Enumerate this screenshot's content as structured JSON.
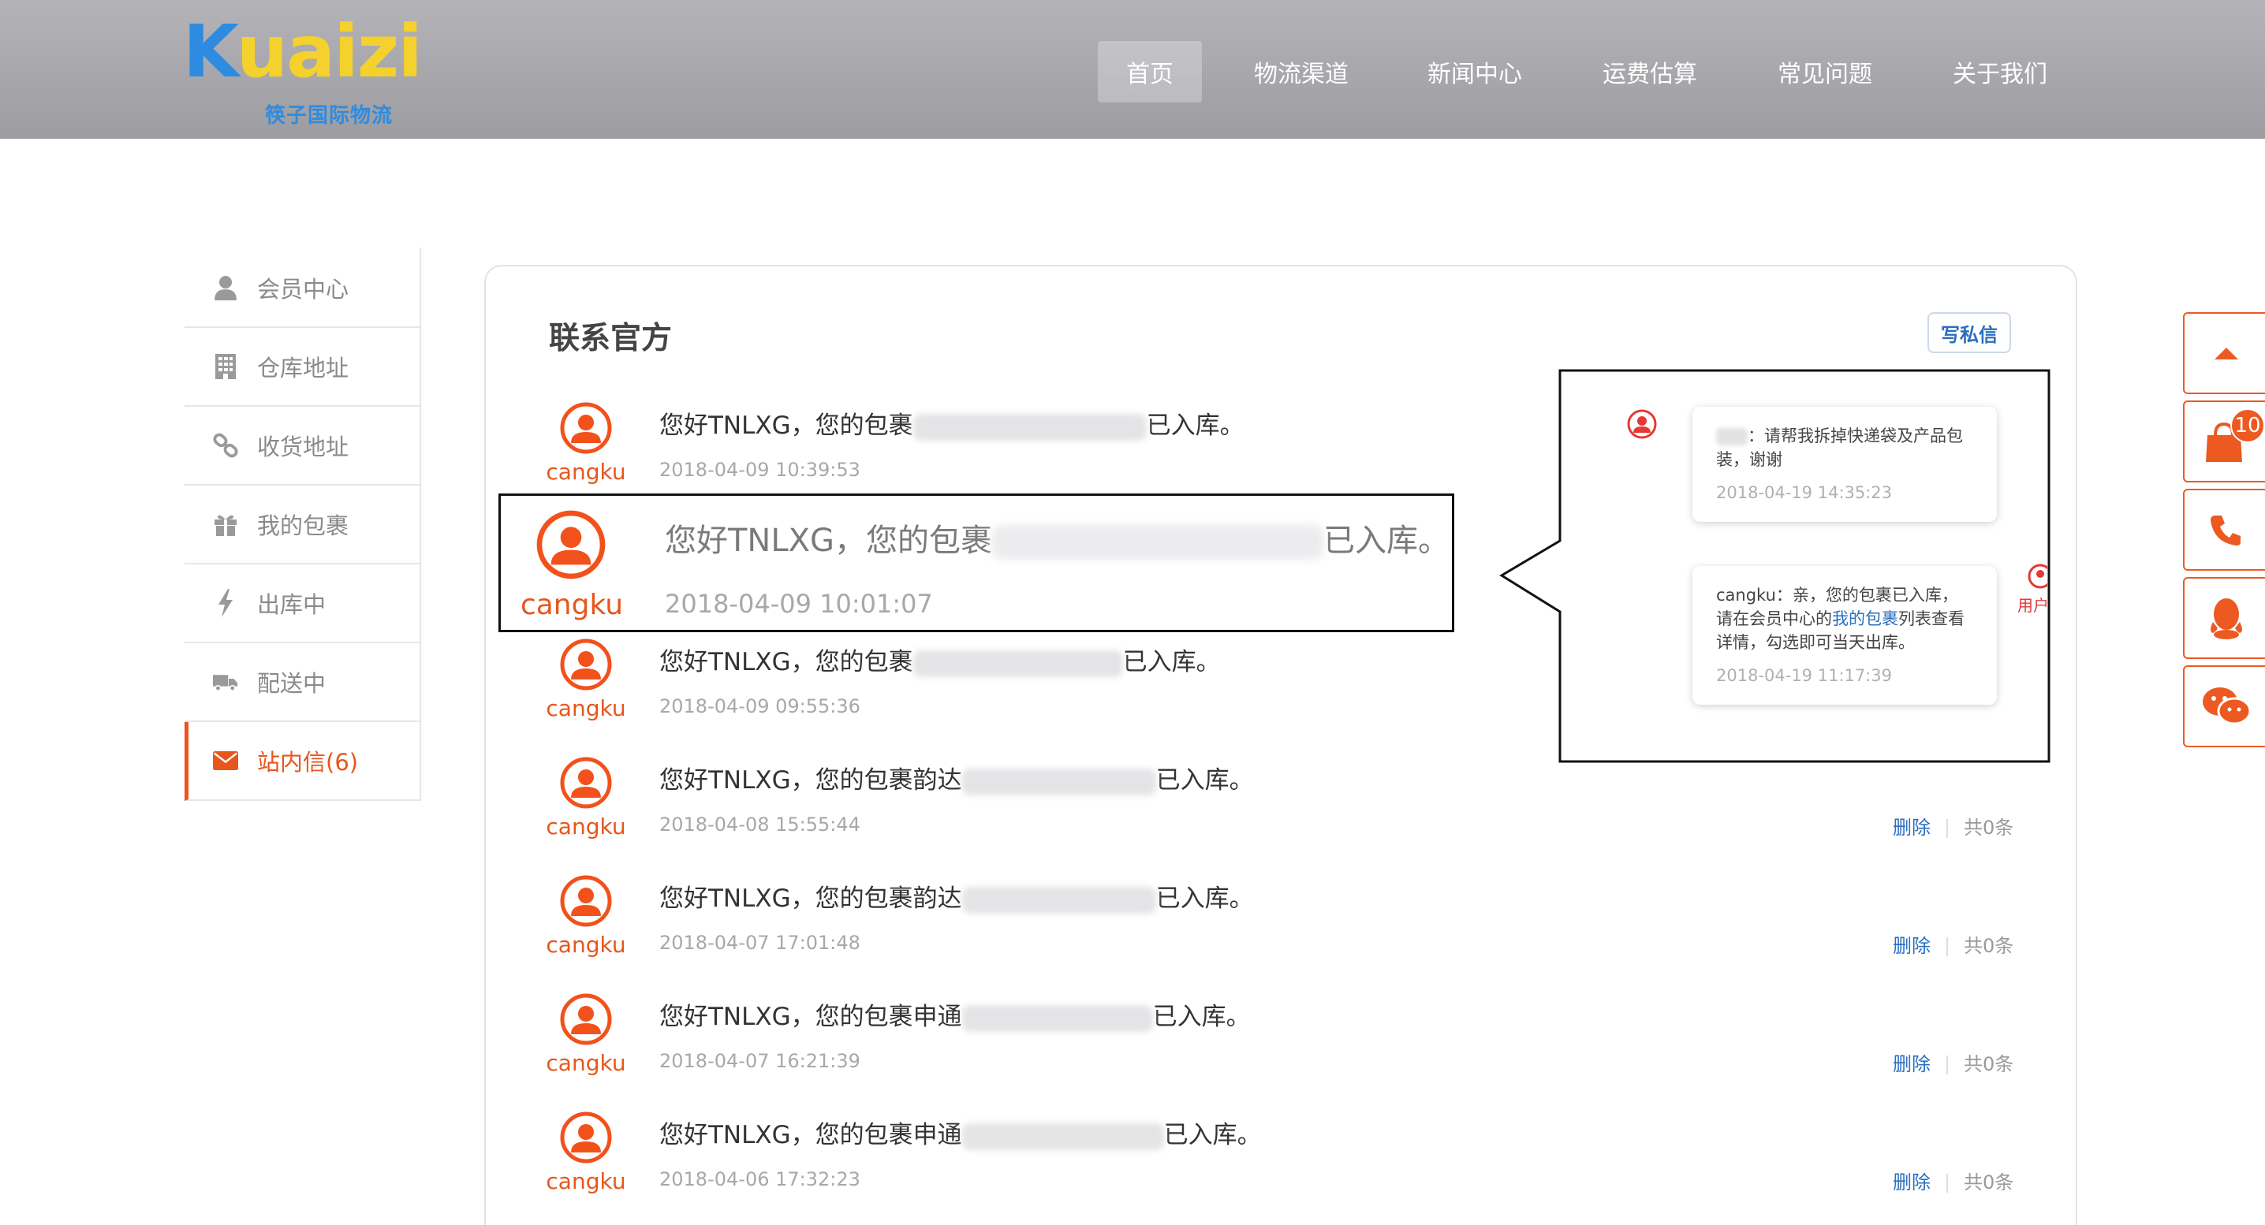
{
  "header": {
    "logo_text": "Kuaizi",
    "logo_sub": "筷子国际物流",
    "nav": [
      "首页",
      "物流渠道",
      "新闻中心",
      "运费估算",
      "常见问题",
      "关于我们"
    ],
    "active_nav": "首页"
  },
  "sidebar": {
    "items": [
      {
        "label": "会员中心",
        "icon": "user-icon"
      },
      {
        "label": "仓库地址",
        "icon": "building-icon"
      },
      {
        "label": "收货地址",
        "icon": "link-icon"
      },
      {
        "label": "我的包裹",
        "icon": "gift-icon"
      },
      {
        "label": "出库中",
        "icon": "lightning-icon"
      },
      {
        "label": "配送中",
        "icon": "truck-icon"
      },
      {
        "label": "站内信(6)",
        "icon": "mail-icon",
        "active": true
      }
    ]
  },
  "main": {
    "title": "联系官方",
    "write_button": "写私信",
    "messages": [
      {
        "sender": "cangku",
        "text_before": "您好TNLXG，您的包裹",
        "text_after": "已入库。",
        "time": "2018-04-09 10:39:53"
      },
      {
        "sender": "cangku",
        "text_before": "您好TNLXG，您的包裹",
        "text_after": "已入库。",
        "time": "2018-04-09 09:55:36"
      },
      {
        "sender": "cangku",
        "text_before": "您好TNLXG，您的包裹韵达",
        "text_after": "已入库。",
        "time": "2018-04-08 15:55:44",
        "delete": "删除",
        "count": "共0条"
      },
      {
        "sender": "cangku",
        "text_before": "您好TNLXG，您的包裹韵达",
        "text_after": "已入库。",
        "time": "2018-04-07 17:01:48",
        "delete": "删除",
        "count": "共0条"
      },
      {
        "sender": "cangku",
        "text_before": "您好TNLXG，您的包裹申通",
        "text_after": "已入库。",
        "time": "2018-04-07 16:21:39",
        "delete": "删除",
        "count": "共0条"
      },
      {
        "sender": "cangku",
        "text_before": "您好TNLXG，您的包裹申通",
        "text_after": "已入库。",
        "time": "2018-04-06 17:32:23",
        "delete": "删除",
        "count": "共0条"
      }
    ],
    "highlight": {
      "sender": "cangku",
      "text_before": "您好TNLXG，您的包裹",
      "text_after": "已入库。",
      "time": "2018-04-09 10:01:07"
    }
  },
  "callout": {
    "msg1": {
      "text": "：请帮我拆掉快递袋及产品包装，谢谢",
      "time": "2018-04-19 14:35:23"
    },
    "msg2": {
      "text_before": "cangku：亲，您的包裹已入库，请在会员中心的",
      "link": "我的包裹",
      "text_after": "列表查看详情，勾选即可当天出库。",
      "time": "2018-04-19 11:17:39"
    },
    "user_label": "用户"
  },
  "right_toolbar": {
    "badge": "10",
    "items": [
      "arrow-up-icon",
      "shopping-bag-icon",
      "phone-icon",
      "qq-icon",
      "wechat-icon"
    ]
  },
  "colors": {
    "accent": "#e8561c",
    "link": "#2a6fbf",
    "header": "#a6a6aa"
  }
}
